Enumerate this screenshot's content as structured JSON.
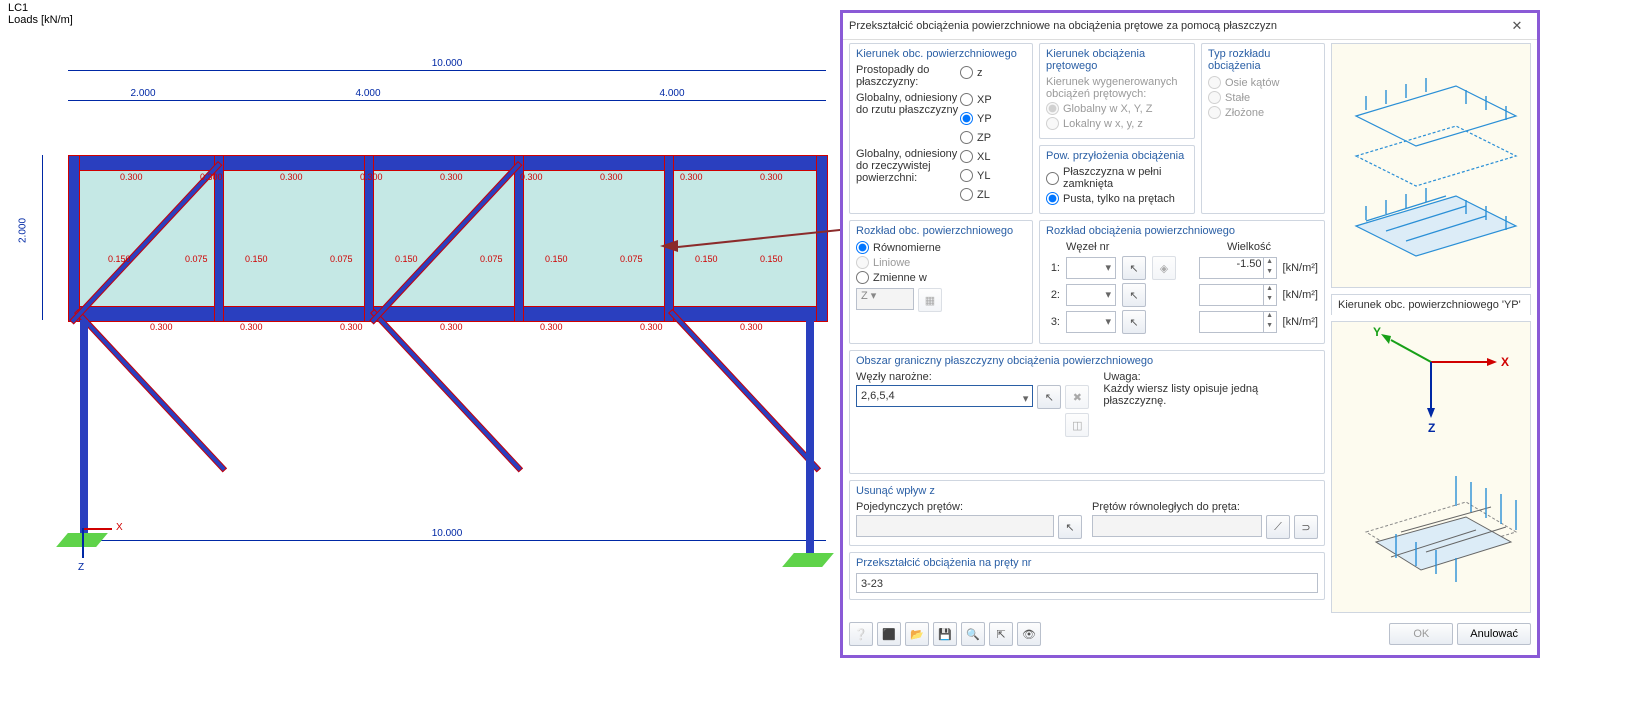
{
  "viewport": {
    "label": "LC1\nLoads [kN/m]"
  },
  "dims": {
    "total": "10.000",
    "a": "2.000",
    "b": "4.000",
    "c": "4.000",
    "height": "2.000",
    "bottom": "10.000"
  },
  "loads": {
    "top": [
      "0.300",
      "0.300",
      "0.300",
      "0.300",
      "0.300",
      "0.300",
      "0.300",
      "0.300",
      "0.300"
    ],
    "mid": [
      "0.150",
      "0.075",
      "0.150",
      "0.075",
      "0.150",
      "0.075",
      "0.150",
      "0.075",
      "0.150"
    ],
    "bot": [
      "0.300",
      "0.300",
      "0.300",
      "0.300",
      "0.300",
      "0.300",
      "0.300"
    ]
  },
  "axes": {
    "x": "X",
    "z": "Z"
  },
  "dialog": {
    "title": "Przekształcić obciążenia powierzchniowe na obciążenia prętowe za pomocą płaszczyzn",
    "g1_hd": "Kierunek obc. powierzchniowego",
    "g1_perp": "Prostopadły do płaszczyzny:",
    "g1_perp_z": "z",
    "g1_proj": "Globalny, odniesiony do rzutu płaszczyzny",
    "g1_true": "Globalny, odniesiony do rzeczywistej powierzchni:",
    "g1_opts": [
      "XP",
      "YP",
      "ZP",
      "XL",
      "YL",
      "ZL"
    ],
    "g2_hd": "Kierunek obciążenia prętowego",
    "g2_sub": "Kierunek wygenerowanych obciążeń prętowych:",
    "g2_o1": "Globalny w X, Y, Z",
    "g2_o2": "Lokalny w x, y, z",
    "g2b_hd": "Pow. przyłożenia obciążenia",
    "g2b_o1": "Płaszczyzna w pełni zamknięta",
    "g2b_o2": "Pusta, tylko na prętach",
    "g3_hd": "Typ rozkładu obciążenia",
    "g3_o1": "Osie kątów",
    "g3_o2": "Stałe",
    "g3_o3": "Złożone",
    "g4_hd": "Rozkład obc. powierzchniowego",
    "g4_o1": "Równomierne",
    "g4_o2": "Liniowe",
    "g4_o3": "Zmienne w",
    "g4_axis": "Z",
    "g5_hd": "Rozkład obciążenia powierzchniowego",
    "g5_node": "Węzeł nr",
    "g5_mag": "Wielkość",
    "g5_rows": [
      "1:",
      "2:",
      "3:"
    ],
    "g5_val": "-1.50",
    "g5_unit": "[kN/m²]",
    "g6_hd": "Obszar graniczny płaszczyzny obciążenia powierzchniowego",
    "g6_lbl": "Węzły narożne:",
    "g6_val": "2,6,5,4",
    "g6_note_hd": "Uwaga:",
    "g6_note": "Każdy wiersz listy opisuje jedną płaszczyznę.",
    "g7_hd": "Usunąć wpływ z",
    "g7_a": "Pojedynczych prętów:",
    "g7_b": "Prętów równoległych do pręta:",
    "g8_hd": "Przekształcić obciążenia na pręty nr",
    "g8_val": "3-23",
    "preview2_hd": "Kierunek obc. powierzchniowego 'YP'",
    "mini_axes": {
      "x": "X",
      "y": "Y",
      "z": "Z"
    },
    "ok": "OK",
    "cancel": "Anulować",
    "toolbar_icons": [
      "help-icon",
      "calc-icon",
      "open-icon",
      "save-icon",
      "zoom-icon",
      "axes-icon",
      "view-icon"
    ]
  }
}
